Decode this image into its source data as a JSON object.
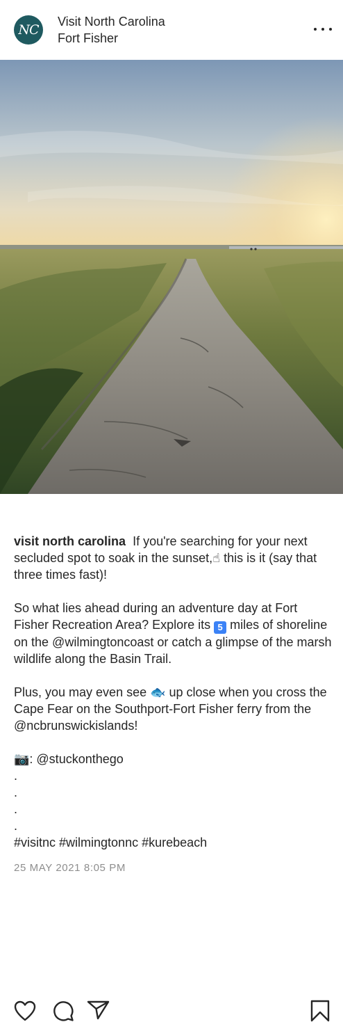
{
  "header": {
    "avatar_text": "NC",
    "account_name": "Visit North Carolina",
    "location": "Fort Fisher",
    "more_icon": "more-horizontal-icon"
  },
  "photo": {
    "description_icon": "post-photo"
  },
  "actions": {
    "like_icon": "heart-icon",
    "comment_icon": "comment-icon",
    "share_icon": "paper-plane-icon",
    "save_icon": "bookmark-icon"
  },
  "caption": {
    "username": "visit north carolina",
    "line1_text": "If you're searching for your next secluded spot to soak in the sunset,☝ this is it (say that three times fast)!",
    "para2_a": "So what lies ahead during an adventure day at Fort Fisher Recreation Area?  Explore its ",
    "para2_num": "5",
    "para2_b": " miles of shoreline on the @wilmingtoncoast or catch a glimpse of the marsh wildlife along the Basin Trail.",
    "para3": "Plus, you may even see 🐟 up close when you cross the Cape Fear on the Southport-Fort Fisher ferry from the @ncbrunswickislands!",
    "credit": "📷: @stuckonthego",
    "dots": [
      ".",
      ".",
      ".",
      "."
    ],
    "hashtags": "#visitnc #wilmingtonnc #kurebeach"
  },
  "timestamp": "25 MAY 2021 8:05 PM"
}
